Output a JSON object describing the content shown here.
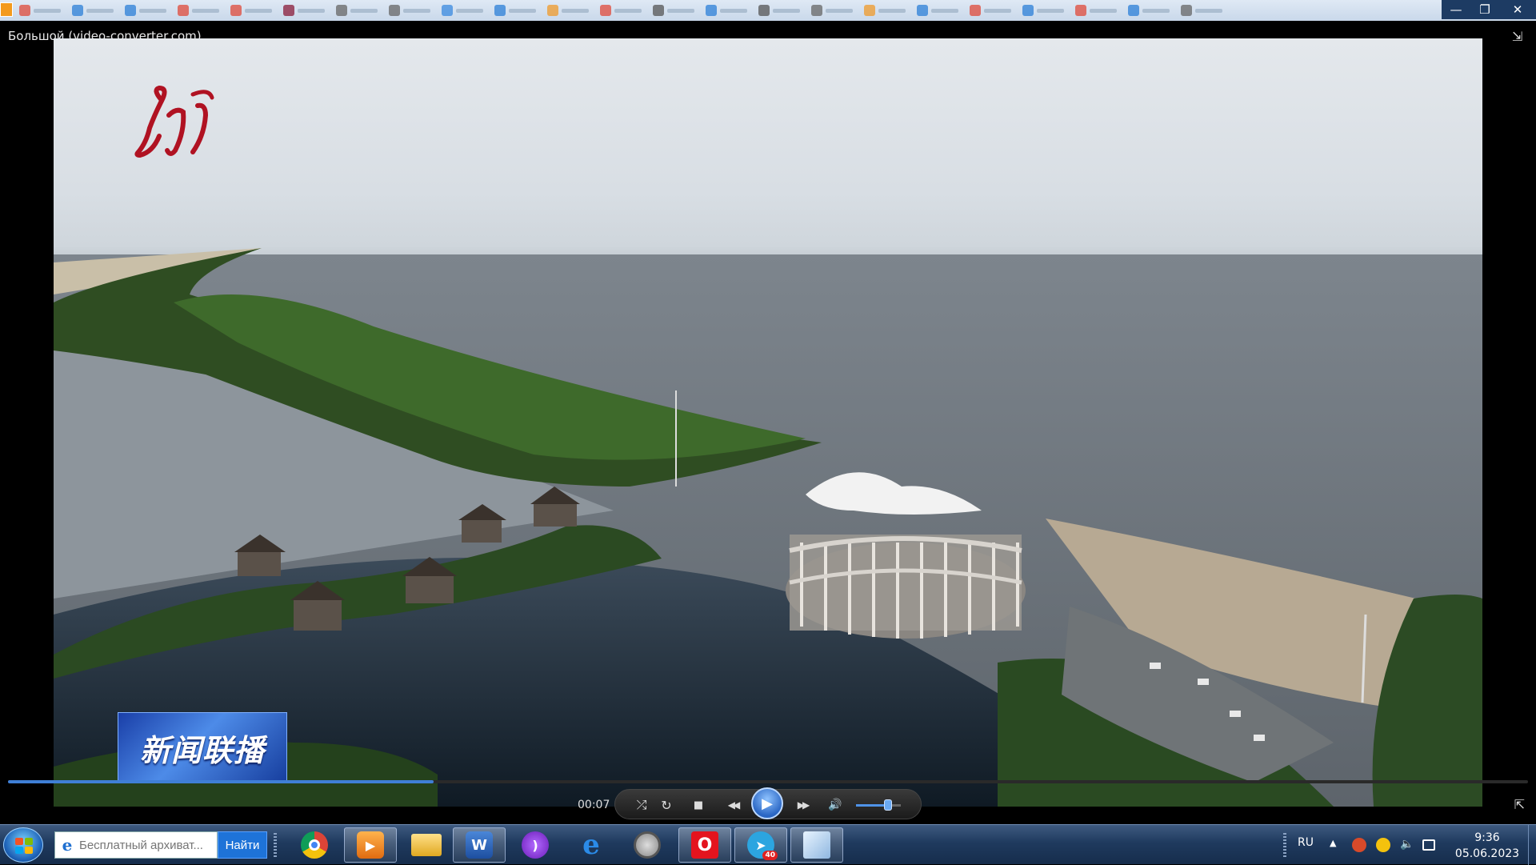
{
  "window": {
    "title": "Большой (video-converter.com)",
    "minimize": "—",
    "maximize": "❐",
    "close": "✕"
  },
  "video": {
    "channel_logo": "logo",
    "news_badge": "新闻联播",
    "progress_fraction": 0.28
  },
  "controls": {
    "time": "00:07",
    "shuffle": "⤮",
    "repeat": "↻",
    "stop": "■",
    "rewind": "◀◀",
    "play": "▶",
    "forward": "▶▶",
    "volume": "🔊",
    "volume_level": 0.72,
    "mini_mode": "⇱",
    "fullscreen_toggle": "⇲"
  },
  "taskbar": {
    "search_placeholder": "Бесплатный архиват...",
    "search_button": "Найти",
    "apps": [
      {
        "name": "chrome-icon"
      },
      {
        "name": "media-player-icon"
      },
      {
        "name": "explorer-icon"
      },
      {
        "name": "word-icon",
        "label": "W"
      },
      {
        "name": "podcast-icon"
      },
      {
        "name": "internet-explorer-icon",
        "label": "e"
      },
      {
        "name": "film-reel-icon"
      },
      {
        "name": "opera-icon",
        "label": "O"
      },
      {
        "name": "telegram-icon",
        "badge": "40"
      },
      {
        "name": "document-icon"
      }
    ],
    "language": "RU",
    "time": "9:36",
    "date": "05.06.2023"
  },
  "colors": {
    "accent": "#3f7fd6",
    "taskbar": "#1f3a5e"
  }
}
